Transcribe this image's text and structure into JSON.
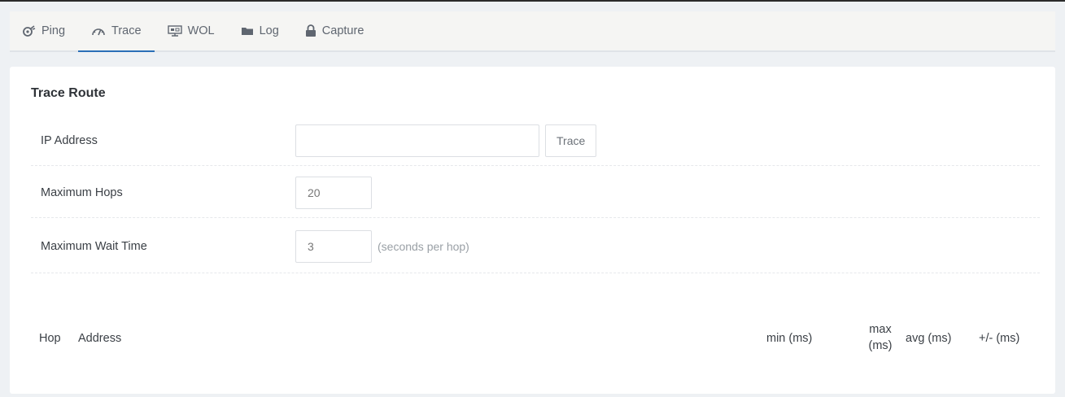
{
  "tabs": [
    {
      "label": "Ping",
      "icon": "ping-icon"
    },
    {
      "label": "Trace",
      "icon": "gauge-icon"
    },
    {
      "label": "WOL",
      "icon": "network-monitor-icon"
    },
    {
      "label": "Log",
      "icon": "folder-icon"
    },
    {
      "label": "Capture",
      "icon": "lock-icon"
    }
  ],
  "active_tab": "Trace",
  "accent_color": "#2a6fb7",
  "trace": {
    "title": "Trace Route",
    "ip_label": "IP Address",
    "ip_value": "",
    "trace_button": "Trace",
    "hops_label": "Maximum Hops",
    "hops_value": "20",
    "wait_label": "Maximum Wait Time",
    "wait_value": "3",
    "wait_hint": "(seconds per hop)"
  },
  "table": {
    "columns": [
      "Hop",
      "Address",
      "min (ms)",
      "max (ms)",
      "avg (ms)",
      "+/- (ms)"
    ],
    "rows": []
  }
}
